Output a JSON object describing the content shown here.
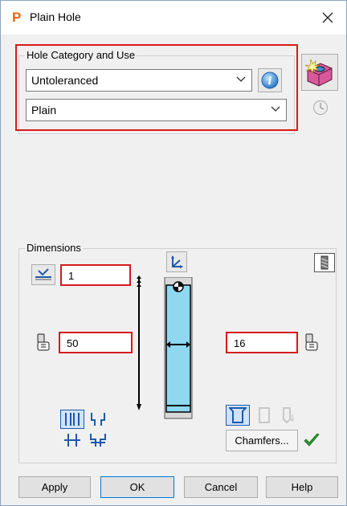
{
  "window": {
    "title": "Plain Hole",
    "app_icon_letter": "P"
  },
  "hole_category": {
    "group_label": "Hole Category and Use",
    "category_value": "Untoleranced",
    "use_value": "Plain"
  },
  "dimensions": {
    "group_label": "Dimensions",
    "top_value": "1",
    "left_value": "50",
    "right_value": "16",
    "chamfers_label": "Chamfers..."
  },
  "buttons": {
    "apply": "Apply",
    "ok": "OK",
    "cancel": "Cancel",
    "help": "Help"
  },
  "colors": {
    "highlight_red": "#d7191c",
    "hole_cyan": "#8fd8f0",
    "check_green": "#2e9a2e",
    "selected_blue": "#1e5aa8"
  }
}
